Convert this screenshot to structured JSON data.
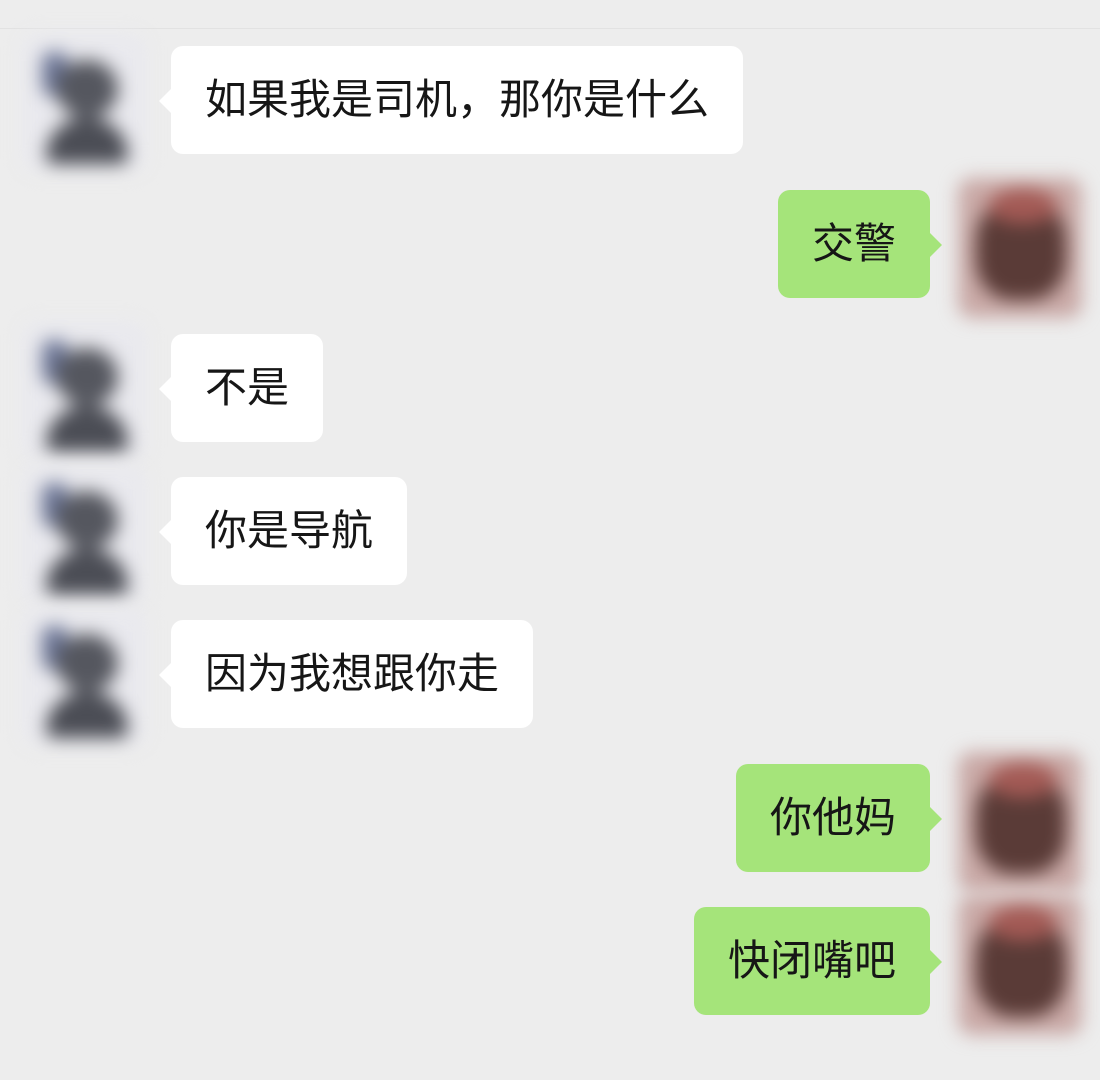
{
  "messages": [
    {
      "side": "in",
      "text": "如果我是司机，那你是什么"
    },
    {
      "side": "out",
      "text": "交警"
    },
    {
      "side": "in",
      "text": "不是"
    },
    {
      "side": "in",
      "text": "你是导航"
    },
    {
      "side": "in",
      "text": "因为我想跟你走"
    },
    {
      "side": "out",
      "text": "你他妈"
    },
    {
      "side": "out",
      "text": "快闭嘴吧"
    }
  ],
  "colors": {
    "background": "#ededed",
    "incoming_bubble": "#ffffff",
    "outgoing_bubble": "#a5e47a",
    "text": "#161616"
  }
}
